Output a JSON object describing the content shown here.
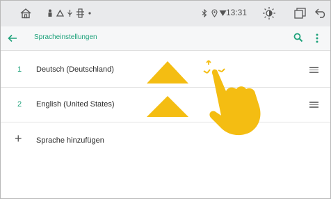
{
  "status_bar": {
    "time": "13:31",
    "icons": [
      "home-icon",
      "person-icon",
      "recycle-icon",
      "usb-icon",
      "bluetooth-icon",
      "dot-icon",
      "location-icon",
      "wifi-icon",
      "brightness-icon",
      "window-icon",
      "back-icon"
    ]
  },
  "app_bar": {
    "title": "Spracheinstellungen",
    "icons": [
      "back-arrow-icon",
      "search-icon",
      "more-icon"
    ]
  },
  "languages": [
    {
      "number": "1",
      "name": "Deutsch (Deutschland)"
    },
    {
      "number": "2",
      "name": "English (United States)"
    }
  ],
  "add_language": {
    "icon": "+",
    "label": "Sprache hinzufügen"
  },
  "colors": {
    "accent": "#1ea27b",
    "gesture": "#f4bd12",
    "status_bar": "#e9eaec"
  },
  "overlay": {
    "gesture": "drag-up-hand-icon",
    "direction": "up"
  }
}
